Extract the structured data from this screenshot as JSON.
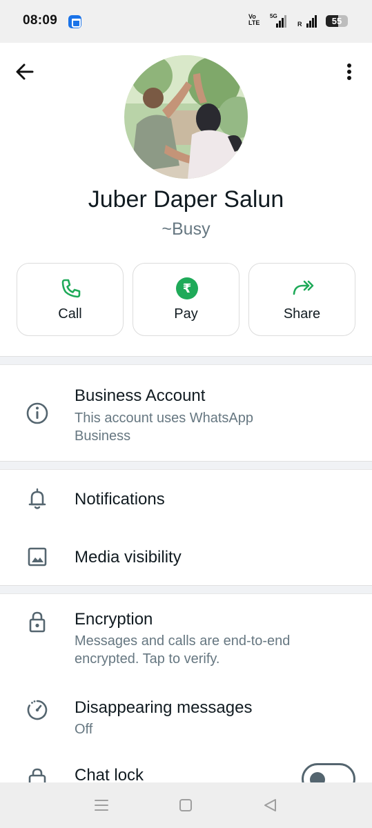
{
  "status_bar": {
    "time": "08:09",
    "volte": "Vo\nLTE",
    "network": "5G",
    "roaming": "R",
    "battery": "55",
    "battery_level": 0.55
  },
  "header": {
    "back_icon": "arrow-left-icon",
    "more_icon": "more-vert-icon"
  },
  "profile": {
    "name": "Juber Daper Salun",
    "about": "~Busy"
  },
  "actions": [
    {
      "label": "Call",
      "icon": "phone-icon"
    },
    {
      "label": "Pay",
      "icon": "rupee-icon",
      "symbol": "₹"
    },
    {
      "label": "Share",
      "icon": "share-forward-icon"
    }
  ],
  "business": {
    "title": "Business Account",
    "subtitle": "This account uses WhatsApp Business"
  },
  "settings": {
    "notifications": "Notifications",
    "media_visibility": "Media visibility"
  },
  "privacy": {
    "encryption_title": "Encryption",
    "encryption_subtitle": "Messages and calls are end-to-end encrypted. Tap to verify.",
    "disappearing_title": "Disappearing messages",
    "disappearing_value": "Off",
    "chat_lock_title": "Chat lock",
    "chat_lock_enabled": false
  },
  "colors": {
    "accent_green": "#1faa59",
    "icon_gray": "#54656f",
    "text_secondary": "#667781"
  }
}
